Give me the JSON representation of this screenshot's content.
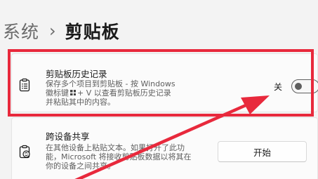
{
  "breadcrumb": {
    "parent": "系统",
    "separator": "›",
    "current": "剪贴板"
  },
  "clipboard_history": {
    "icon": "clipboard-list-icon",
    "title": "剪贴板历史记录",
    "desc_line1": "保存多个项目到剪贴板 - 按 Windows",
    "desc_line2_before": "徽标键",
    "desc_line2_after": "+ V 以查看剪贴板历史记录",
    "desc_line3": "并粘贴其中的内容。",
    "toggle_state_label": "关",
    "toggle_on": false
  },
  "cross_device": {
    "icon": "clipboard-sync-icon",
    "title": "跨设备共享",
    "desc_line1": "在其他设备上粘贴文本。如果打开了此功",
    "desc_line2": "能，Microsoft 将接收剪贴板数据以将其在",
    "desc_line3": "你的设备之间共享。",
    "button_label": "开始"
  },
  "annotation": {
    "highlight_color": "#e8293c",
    "arrow_color": "#e8293c"
  }
}
